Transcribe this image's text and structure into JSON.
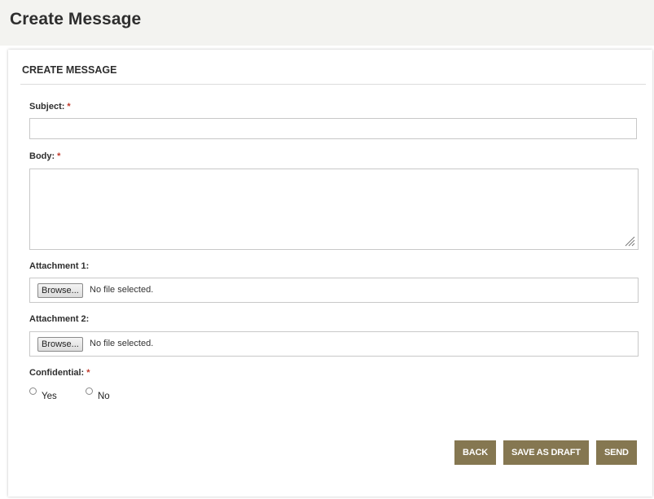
{
  "page": {
    "title": "Create Message"
  },
  "panel": {
    "title": "CREATE MESSAGE"
  },
  "form": {
    "subject": {
      "label": "Subject:",
      "required_mark": "*",
      "value": ""
    },
    "body": {
      "label": "Body:",
      "required_mark": "*",
      "value": ""
    },
    "attachment1": {
      "label": "Attachment 1:",
      "browse_label": "Browse...",
      "status": "No file selected."
    },
    "attachment2": {
      "label": "Attachment 2:",
      "browse_label": "Browse...",
      "status": "No file selected."
    },
    "confidential": {
      "label": "Confidential:",
      "required_mark": "*",
      "options": [
        {
          "label": "Yes",
          "selected": false
        },
        {
          "label": "No",
          "selected": false
        }
      ]
    }
  },
  "actions": {
    "back_label": "BACK",
    "save_draft_label": "SAVE AS DRAFT",
    "send_label": "SEND"
  },
  "colors": {
    "button_bg": "#857751",
    "required": "#c0392b",
    "header_bg": "#f3f3f0"
  }
}
